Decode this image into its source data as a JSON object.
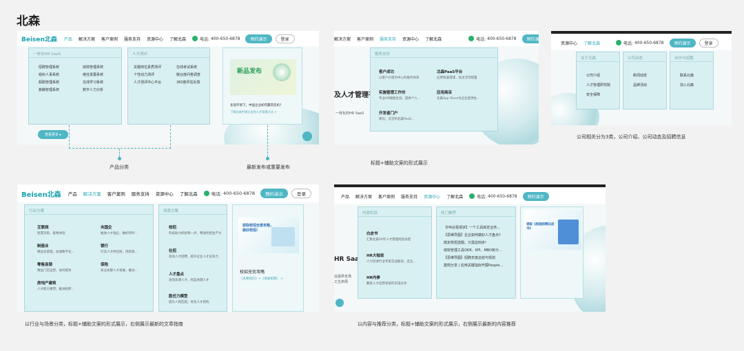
{
  "page_title": "北森",
  "nav_common": {
    "logo": "Beisen北森",
    "products": "产品",
    "solutions": "解决方案",
    "cases": "客户案例",
    "service": "服务支持",
    "resources": "资源中心",
    "about": "了解北森",
    "phone": "400-650-6878",
    "phone_prefix": "电话:",
    "demo": "预约演示",
    "login": "登录"
  },
  "p1": {
    "box1_title": "一体化HR SaaS",
    "col1": [
      "招聘管理系统",
      "组织人事系统",
      "假勤管理系统",
      "薪酬管理系统"
    ],
    "col2": [
      "绩效管理系统",
      "继任发展系统",
      "在线学习系统",
      "数字人力分析"
    ],
    "box2_title": "人才测评",
    "col3": [
      "关键岗位素质测评",
      "个性动力测评",
      "人才测评中心平台"
    ],
    "col4": [
      "在线考试系统",
      "敬业度问卷调查",
      "360度评估反馈"
    ],
    "poster_title": "新品发布",
    "card_text": "多变环境下，中国企业如何赢得先机？",
    "card_link": "了解北森中国企业的人才管理方法 >",
    "more_btn": "查看更多",
    "caption_left": "产品分类",
    "caption_right": "最新发布或重要发布"
  },
  "p2": {
    "menu_title": "服务支持",
    "items": [
      {
        "t": "客户成功",
        "s": "以客户价值为中心的服务体系"
      },
      {
        "t": "北森PaaS平台",
        "s": "应用快速搭建，高灵活可配置"
      },
      {
        "t": "实施管理工作坊",
        "s": "专业HR赋能生涯，提供个人..."
      },
      {
        "t": "应用商店",
        "s": "北森App Store为企业提供生..."
      },
      {
        "t": "开发者门户",
        "s": "简化、灵活的北森PaaS..."
      }
    ],
    "hero_text": "及人才管理平",
    "hero_sub": "一体化的HR SaaS",
    "caption": "标题+辅助文案的形式展示"
  },
  "p3": {
    "box1_title": "关于北森",
    "col1": [
      "公司介绍",
      "人才管理研究院",
      "安全保障"
    ],
    "box2_title": "公司动态",
    "col2": [
      "新闻动态",
      "品牌活动"
    ],
    "box3_title": "合作与招聘",
    "col3": [
      "联系北森",
      "加入北森"
    ],
    "caption": "公司相关分为3类，公司介绍、公司动态及招聘信息"
  },
  "p4": {
    "box1_title": "行业方案",
    "industries": [
      {
        "t": "互联网",
        "s": "智慧决策，极致体验"
      },
      {
        "t": "央国企",
        "s": "推进人才强企，做好新时..."
      },
      {
        "t": "制造业",
        "s": "精益化管理，加速数字化..."
      },
      {
        "t": "银行",
        "s": "打造人才供应链，持续保..."
      },
      {
        "t": "零售连锁",
        "s": "精益门店运营，协同提效"
      },
      {
        "t": "保险",
        "s": "关注关键人才发展，推动..."
      },
      {
        "t": "房地产建筑",
        "s": "人才能力重塑，推进组织..."
      }
    ],
    "box2_title": "场景方案",
    "scenes": [
      {
        "t": "校招",
        "s": "科技助力校招每一步，释放校招生产力"
      },
      {
        "t": "社招",
        "s": "高效人才招聘，提升企业人才竞争力"
      },
      {
        "t": "人才盘点",
        "s": "发现高潜人才，绘蓝关键人才"
      },
      {
        "t": "胜任力模型",
        "s": "提升人岗匹配，优化人才结构"
      }
    ],
    "card_title": "校招无忧攻略",
    "card_link": "《主要经历》+《发展指南》 >",
    "poster_text": "获取校招全景攻略，做好校招!",
    "caption": "以行业与场景分类，标题+辅助文案的形式展示，右侧展示最新的文章指南"
  },
  "p5": {
    "box1_title": "内容栏目",
    "items": [
      {
        "t": "白皮书",
        "s": "汇集北森20年人才管理经验总结"
      },
      {
        "t": "HR大咖说",
        "s": "人力资源行业专家实战解读，名企..."
      },
      {
        "t": "HR内参",
        "s": "聚焦人才选用育留的实操分享"
      }
    ],
    "box2_title": "热门推荐",
    "hot": [
      "【HR必看现状】一个工具就定业务...",
      "【思维导图】企业如何做好人才盘点?",
      "搞定校招选题，只需这四步!",
      "绩效管理工具OKR、KPI、MBO有什...",
      "【思维导图】招聘年度总结与规划",
      "案例分享 | 应用关键指标开展People..."
    ],
    "poster_text": "领取《校园招聘白皮书》",
    "caption": "以内容与推荐分类，标题+辅助文案的形式展示，右侧展示最新的内容推荐"
  }
}
